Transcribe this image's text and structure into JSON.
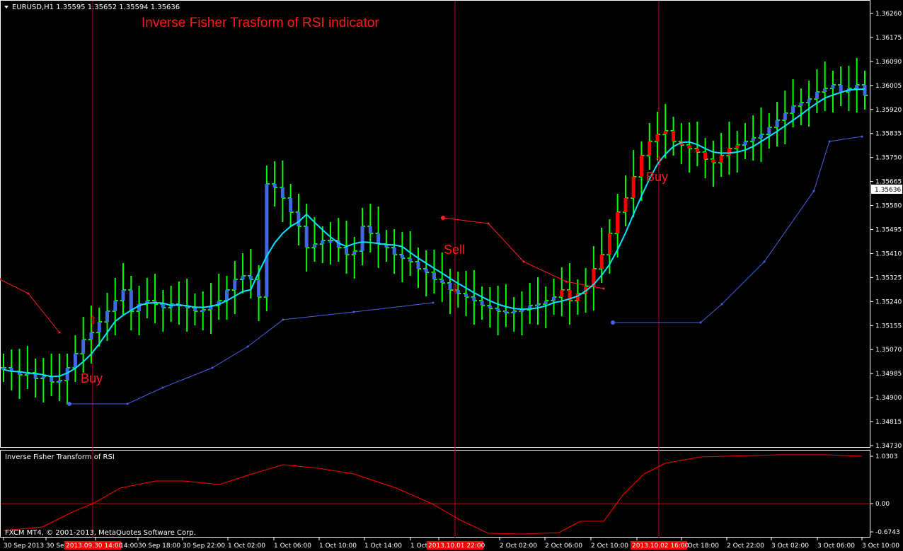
{
  "header": {
    "symbol_line": "EURUSD,H1  1.35595 1.35652 1.35594 1.35636",
    "title": "Inverse Fisher Trasform of RSI indicator"
  },
  "annotations": {
    "buy1": "Buy",
    "buy2": "Buy",
    "sell": "Sell"
  },
  "price_axis": {
    "ticks": [
      "1.36260",
      "1.36175",
      "1.36090",
      "1.36005",
      "1.35920",
      "1.35835",
      "1.35750",
      "1.35665",
      "1.35580",
      "1.35495",
      "1.35410",
      "1.35325",
      "1.35240",
      "1.35155",
      "1.35070",
      "1.34985",
      "1.34900",
      "1.34815",
      "1.34730"
    ],
    "current_price": "1.35636",
    "range": [
      1.3473,
      1.3626
    ]
  },
  "indicator": {
    "name": "Inverse Fisher Transform of RSI",
    "ticks": [
      "1.0303",
      "0.00",
      "-0.6743"
    ],
    "range": [
      -0.6743,
      1.0303
    ]
  },
  "footer": {
    "copyright": "FXCM MT4, © 2001-2013, MetaQuotes Software Corp."
  },
  "time_axis": {
    "labels": [
      "30 Sep 2013",
      "30 Sep 10:00",
      "30 Sep 14:00",
      "30 Sep 18:00",
      "30 Sep 22:00",
      "1 Oct 02:00",
      "1 Oct 06:00",
      "1 Oct 10:00",
      "1 Oct 14:00",
      "1 Oct 18:00",
      "1 Oct 22:00",
      "2 Oct 02:00",
      "2 Oct 06:00",
      "2 Oct 10:00",
      "2 Oct 14:00",
      "2 Oct 18:00",
      "2 Oct 22:00",
      "3 Oct 02:00",
      "3 Oct 06:00",
      "3 Oct 10:00"
    ],
    "highlighted": [
      "2013.09.30 14:00",
      "2013.10.01 22:00",
      "2013.10.02 16:00"
    ]
  },
  "colors": {
    "bull": "#00ff00",
    "bull_body": "#4169e1",
    "bear_body": "#ff0000",
    "ma": "#00e5ff",
    "stop_low": "#4a5fe0",
    "stop_high": "#ff2020",
    "vline": "#c0002a",
    "axis": "#ffffff"
  }
}
